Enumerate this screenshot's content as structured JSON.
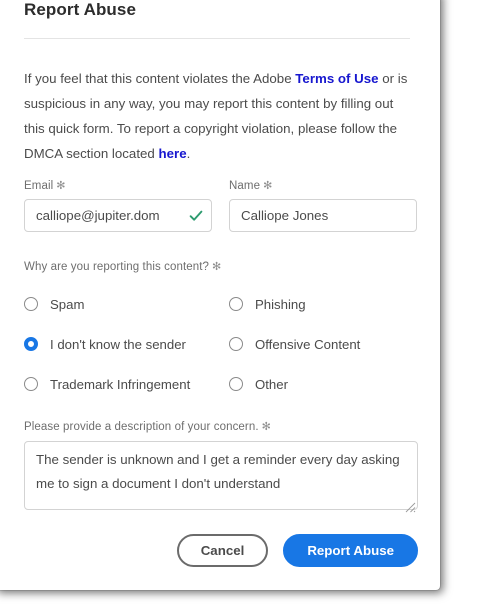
{
  "dialog": {
    "title": "Report Abuse",
    "intro": {
      "part1": "If you feel that this content violates the Adobe ",
      "link_terms": "Terms of Use",
      "part2": " or is suspicious in any way, you may report this content by filling out this quick form. To report a copyright violation, please follow the DMCA section located ",
      "link_here": "here",
      "part3": "."
    }
  },
  "form": {
    "email": {
      "label": "Email",
      "required_marker": "✻",
      "value": "calliope@jupiter.dom",
      "placeholder": "",
      "valid_icon": "check-icon",
      "valid": true
    },
    "name": {
      "label": "Name",
      "required_marker": "✻",
      "value": "Calliope Jones",
      "placeholder": ""
    },
    "reason": {
      "label": "Why are you reporting this content?",
      "required_marker": "✻",
      "selected": "I don't know the sender",
      "options": [
        {
          "label": "Spam",
          "checked": false
        },
        {
          "label": "Phishing",
          "checked": false
        },
        {
          "label": "I don't know the sender",
          "checked": true
        },
        {
          "label": "Offensive Content",
          "checked": false
        },
        {
          "label": "Trademark Infringement",
          "checked": false
        },
        {
          "label": "Other",
          "checked": false
        }
      ]
    },
    "description": {
      "label": "Please provide a description of your concern.",
      "required_marker": "✻",
      "value": "The sender is unknown and I get a reminder every day asking me to sign a document I don't understand",
      "placeholder": ""
    }
  },
  "footer": {
    "cancel_label": "Cancel",
    "submit_label": "Report Abuse"
  },
  "colors": {
    "accent_blue": "#1877e5",
    "link_blue": "#1717cf",
    "valid_green": "#2d9b6f",
    "text": "#4b4b4b",
    "label": "#6e6e6e",
    "border": "#d3d3d3"
  }
}
